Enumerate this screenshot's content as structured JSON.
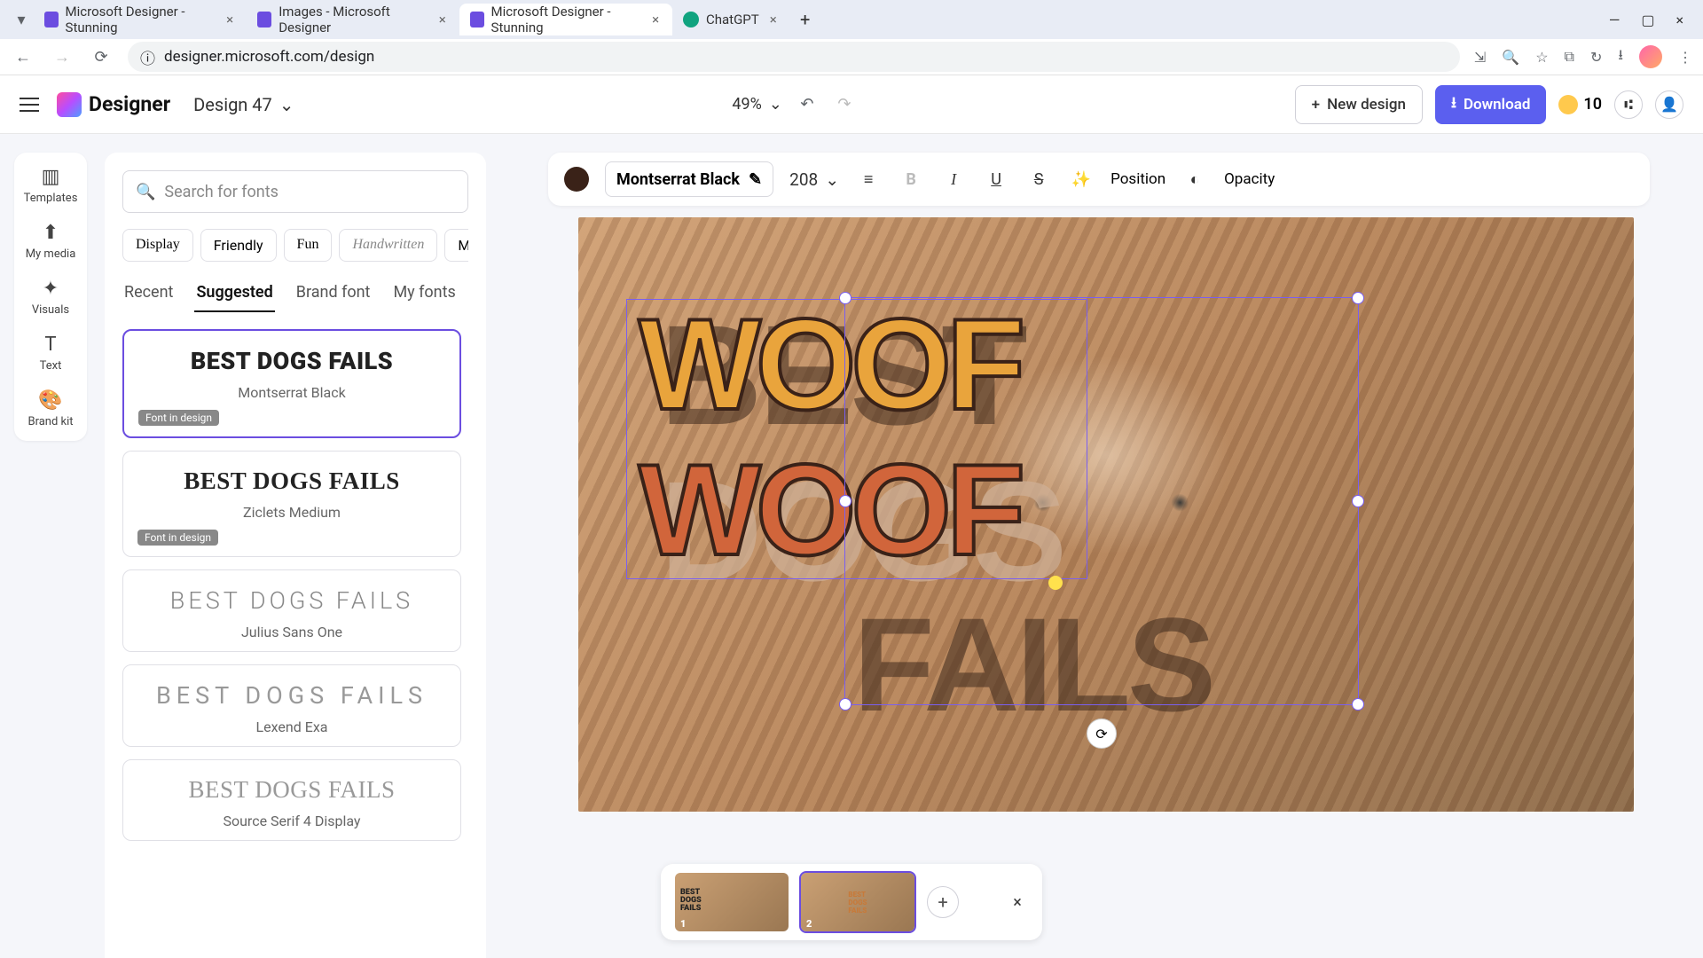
{
  "browser": {
    "tabs": [
      {
        "title": "Microsoft Designer - Stunning"
      },
      {
        "title": "Images - Microsoft Designer"
      },
      {
        "title": "Microsoft Designer - Stunning"
      },
      {
        "title": "ChatGPT"
      }
    ],
    "url": "designer.microsoft.com/design"
  },
  "header": {
    "app_name": "Designer",
    "doc_name": "Design 47",
    "zoom": "49%",
    "new_design": "New design",
    "download": "Download",
    "coins": "10"
  },
  "rail": {
    "templates": "Templates",
    "mymedia": "My media",
    "visuals": "Visuals",
    "text": "Text",
    "brandkit": "Brand kit"
  },
  "font_panel": {
    "search_placeholder": "Search for fonts",
    "chips": [
      "Display",
      "Friendly",
      "Fun",
      "Handwritten",
      "Mo"
    ],
    "tabs": {
      "recent": "Recent",
      "suggested": "Suggested",
      "brand": "Brand font",
      "my": "My fonts"
    },
    "sample_text": "BEST DOGS FAILS",
    "in_design": "Font in design",
    "fonts": [
      {
        "name": "Montserrat Black",
        "in": true,
        "sel": true
      },
      {
        "name": "Ziclets Medium",
        "in": true
      },
      {
        "name": "Julius Sans One"
      },
      {
        "name": "Lexend Exa"
      },
      {
        "name": "Source Serif 4 Display"
      }
    ]
  },
  "prop_bar": {
    "font": "Montserrat Black",
    "size": "208",
    "position": "Position",
    "opacity": "Opacity"
  },
  "canvas": {
    "bg_lines": [
      "BEST",
      "DOGS",
      "FAILS"
    ],
    "woof": "WOOF"
  },
  "pages": {
    "n1": "1",
    "n2": "2"
  }
}
